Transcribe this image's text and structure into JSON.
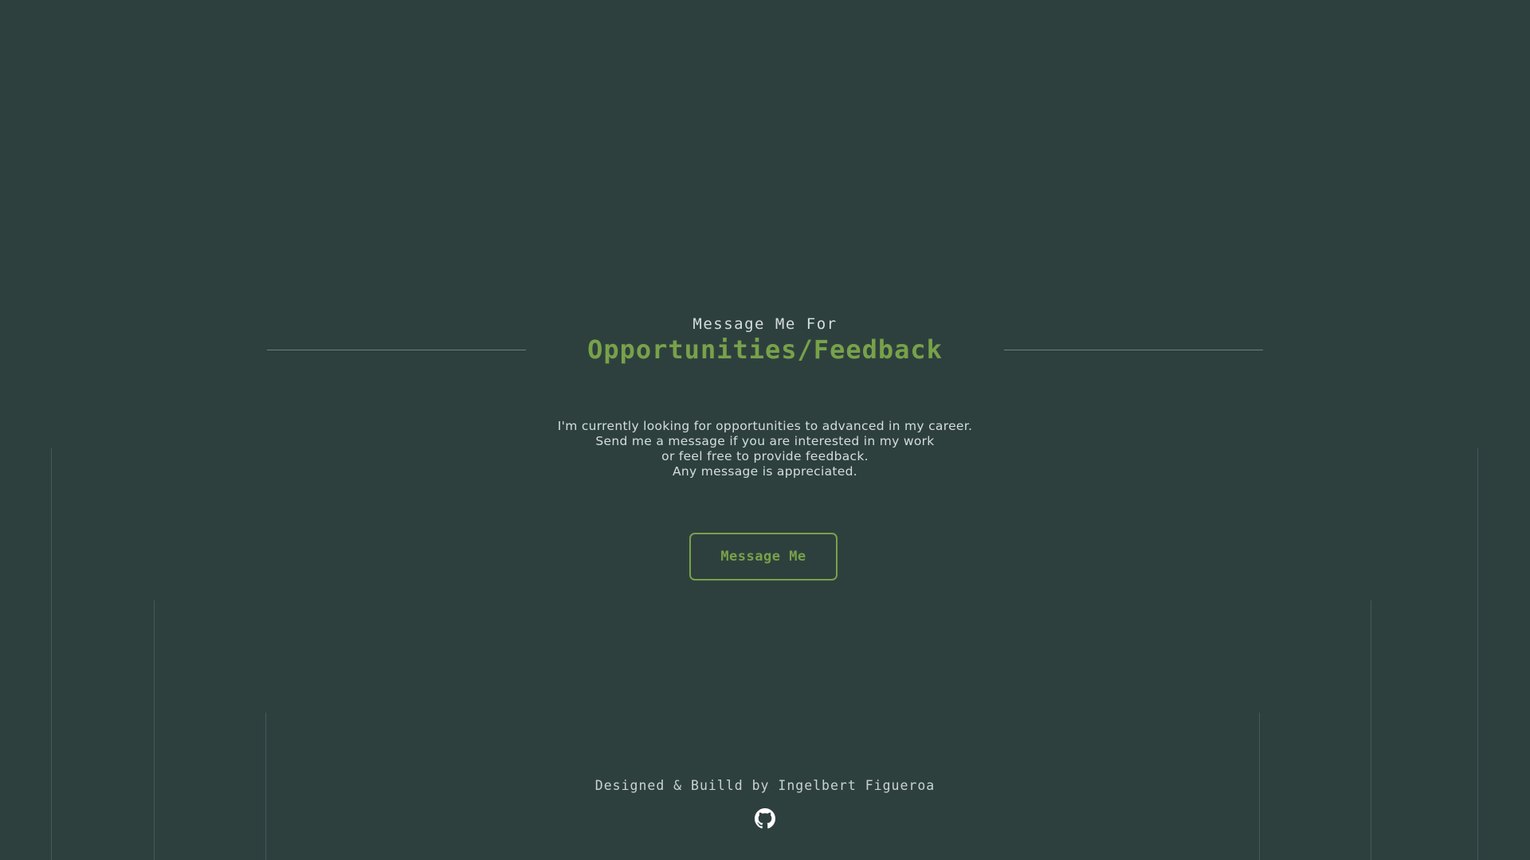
{
  "contact": {
    "subtitle": "Message Me For",
    "title": "Opportunities/Feedback",
    "description_lines": [
      "I'm currently looking for opportunities to advanced in my career.",
      "Send me a message if you are interested in my work",
      "or feel free to provide feedback.",
      "Any message is appreciated."
    ],
    "button_label": "Message Me"
  },
  "footer": {
    "credit": "Designed & Builld by Ingelbert Figueroa",
    "github_icon": "github-icon"
  },
  "colors": {
    "background": "#2e403e",
    "accent": "#78a14a",
    "text": "#d4dedc",
    "divider": "#6f7f80"
  }
}
